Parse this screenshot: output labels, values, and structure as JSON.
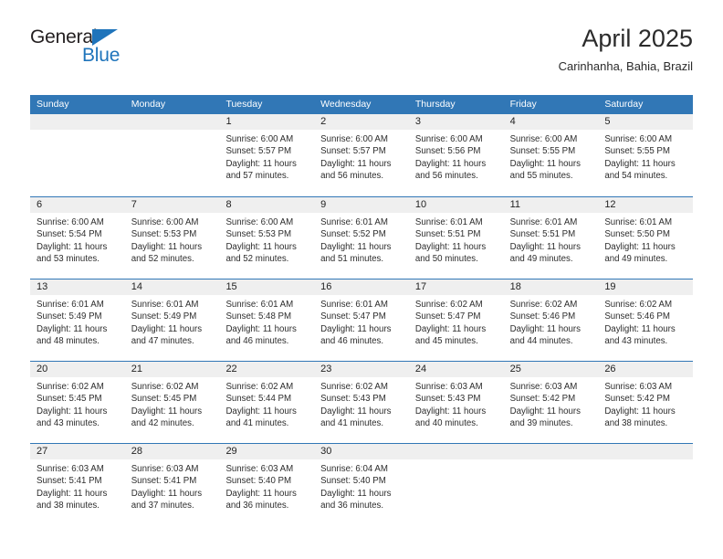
{
  "brand": {
    "name_dark": "General",
    "name_blue": "Blue",
    "accent_color": "#1f74bb"
  },
  "header": {
    "title": "April 2025",
    "subtitle": "Carinhanha, Bahia, Brazil"
  },
  "theme": {
    "header_blue": "#3177b6",
    "day_band_gray": "#efefef",
    "text_color": "#2d2d2d"
  },
  "weekdays": [
    "Sunday",
    "Monday",
    "Tuesday",
    "Wednesday",
    "Thursday",
    "Friday",
    "Saturday"
  ],
  "weeks": [
    [
      {
        "day": "",
        "empty": true
      },
      {
        "day": "",
        "empty": true
      },
      {
        "day": "1",
        "sunrise": "Sunrise: 6:00 AM",
        "sunset": "Sunset: 5:57 PM",
        "daylight1": "Daylight: 11 hours",
        "daylight2": "and 57 minutes."
      },
      {
        "day": "2",
        "sunrise": "Sunrise: 6:00 AM",
        "sunset": "Sunset: 5:57 PM",
        "daylight1": "Daylight: 11 hours",
        "daylight2": "and 56 minutes."
      },
      {
        "day": "3",
        "sunrise": "Sunrise: 6:00 AM",
        "sunset": "Sunset: 5:56 PM",
        "daylight1": "Daylight: 11 hours",
        "daylight2": "and 56 minutes."
      },
      {
        "day": "4",
        "sunrise": "Sunrise: 6:00 AM",
        "sunset": "Sunset: 5:55 PM",
        "daylight1": "Daylight: 11 hours",
        "daylight2": "and 55 minutes."
      },
      {
        "day": "5",
        "sunrise": "Sunrise: 6:00 AM",
        "sunset": "Sunset: 5:55 PM",
        "daylight1": "Daylight: 11 hours",
        "daylight2": "and 54 minutes."
      }
    ],
    [
      {
        "day": "6",
        "sunrise": "Sunrise: 6:00 AM",
        "sunset": "Sunset: 5:54 PM",
        "daylight1": "Daylight: 11 hours",
        "daylight2": "and 53 minutes."
      },
      {
        "day": "7",
        "sunrise": "Sunrise: 6:00 AM",
        "sunset": "Sunset: 5:53 PM",
        "daylight1": "Daylight: 11 hours",
        "daylight2": "and 52 minutes."
      },
      {
        "day": "8",
        "sunrise": "Sunrise: 6:00 AM",
        "sunset": "Sunset: 5:53 PM",
        "daylight1": "Daylight: 11 hours",
        "daylight2": "and 52 minutes."
      },
      {
        "day": "9",
        "sunrise": "Sunrise: 6:01 AM",
        "sunset": "Sunset: 5:52 PM",
        "daylight1": "Daylight: 11 hours",
        "daylight2": "and 51 minutes."
      },
      {
        "day": "10",
        "sunrise": "Sunrise: 6:01 AM",
        "sunset": "Sunset: 5:51 PM",
        "daylight1": "Daylight: 11 hours",
        "daylight2": "and 50 minutes."
      },
      {
        "day": "11",
        "sunrise": "Sunrise: 6:01 AM",
        "sunset": "Sunset: 5:51 PM",
        "daylight1": "Daylight: 11 hours",
        "daylight2": "and 49 minutes."
      },
      {
        "day": "12",
        "sunrise": "Sunrise: 6:01 AM",
        "sunset": "Sunset: 5:50 PM",
        "daylight1": "Daylight: 11 hours",
        "daylight2": "and 49 minutes."
      }
    ],
    [
      {
        "day": "13",
        "sunrise": "Sunrise: 6:01 AM",
        "sunset": "Sunset: 5:49 PM",
        "daylight1": "Daylight: 11 hours",
        "daylight2": "and 48 minutes."
      },
      {
        "day": "14",
        "sunrise": "Sunrise: 6:01 AM",
        "sunset": "Sunset: 5:49 PM",
        "daylight1": "Daylight: 11 hours",
        "daylight2": "and 47 minutes."
      },
      {
        "day": "15",
        "sunrise": "Sunrise: 6:01 AM",
        "sunset": "Sunset: 5:48 PM",
        "daylight1": "Daylight: 11 hours",
        "daylight2": "and 46 minutes."
      },
      {
        "day": "16",
        "sunrise": "Sunrise: 6:01 AM",
        "sunset": "Sunset: 5:47 PM",
        "daylight1": "Daylight: 11 hours",
        "daylight2": "and 46 minutes."
      },
      {
        "day": "17",
        "sunrise": "Sunrise: 6:02 AM",
        "sunset": "Sunset: 5:47 PM",
        "daylight1": "Daylight: 11 hours",
        "daylight2": "and 45 minutes."
      },
      {
        "day": "18",
        "sunrise": "Sunrise: 6:02 AM",
        "sunset": "Sunset: 5:46 PM",
        "daylight1": "Daylight: 11 hours",
        "daylight2": "and 44 minutes."
      },
      {
        "day": "19",
        "sunrise": "Sunrise: 6:02 AM",
        "sunset": "Sunset: 5:46 PM",
        "daylight1": "Daylight: 11 hours",
        "daylight2": "and 43 minutes."
      }
    ],
    [
      {
        "day": "20",
        "sunrise": "Sunrise: 6:02 AM",
        "sunset": "Sunset: 5:45 PM",
        "daylight1": "Daylight: 11 hours",
        "daylight2": "and 43 minutes."
      },
      {
        "day": "21",
        "sunrise": "Sunrise: 6:02 AM",
        "sunset": "Sunset: 5:45 PM",
        "daylight1": "Daylight: 11 hours",
        "daylight2": "and 42 minutes."
      },
      {
        "day": "22",
        "sunrise": "Sunrise: 6:02 AM",
        "sunset": "Sunset: 5:44 PM",
        "daylight1": "Daylight: 11 hours",
        "daylight2": "and 41 minutes."
      },
      {
        "day": "23",
        "sunrise": "Sunrise: 6:02 AM",
        "sunset": "Sunset: 5:43 PM",
        "daylight1": "Daylight: 11 hours",
        "daylight2": "and 41 minutes."
      },
      {
        "day": "24",
        "sunrise": "Sunrise: 6:03 AM",
        "sunset": "Sunset: 5:43 PM",
        "daylight1": "Daylight: 11 hours",
        "daylight2": "and 40 minutes."
      },
      {
        "day": "25",
        "sunrise": "Sunrise: 6:03 AM",
        "sunset": "Sunset: 5:42 PM",
        "daylight1": "Daylight: 11 hours",
        "daylight2": "and 39 minutes."
      },
      {
        "day": "26",
        "sunrise": "Sunrise: 6:03 AM",
        "sunset": "Sunset: 5:42 PM",
        "daylight1": "Daylight: 11 hours",
        "daylight2": "and 38 minutes."
      }
    ],
    [
      {
        "day": "27",
        "sunrise": "Sunrise: 6:03 AM",
        "sunset": "Sunset: 5:41 PM",
        "daylight1": "Daylight: 11 hours",
        "daylight2": "and 38 minutes."
      },
      {
        "day": "28",
        "sunrise": "Sunrise: 6:03 AM",
        "sunset": "Sunset: 5:41 PM",
        "daylight1": "Daylight: 11 hours",
        "daylight2": "and 37 minutes."
      },
      {
        "day": "29",
        "sunrise": "Sunrise: 6:03 AM",
        "sunset": "Sunset: 5:40 PM",
        "daylight1": "Daylight: 11 hours",
        "daylight2": "and 36 minutes."
      },
      {
        "day": "30",
        "sunrise": "Sunrise: 6:04 AM",
        "sunset": "Sunset: 5:40 PM",
        "daylight1": "Daylight: 11 hours",
        "daylight2": "and 36 minutes."
      },
      {
        "day": "",
        "empty": true
      },
      {
        "day": "",
        "empty": true
      },
      {
        "day": "",
        "empty": true
      }
    ]
  ]
}
